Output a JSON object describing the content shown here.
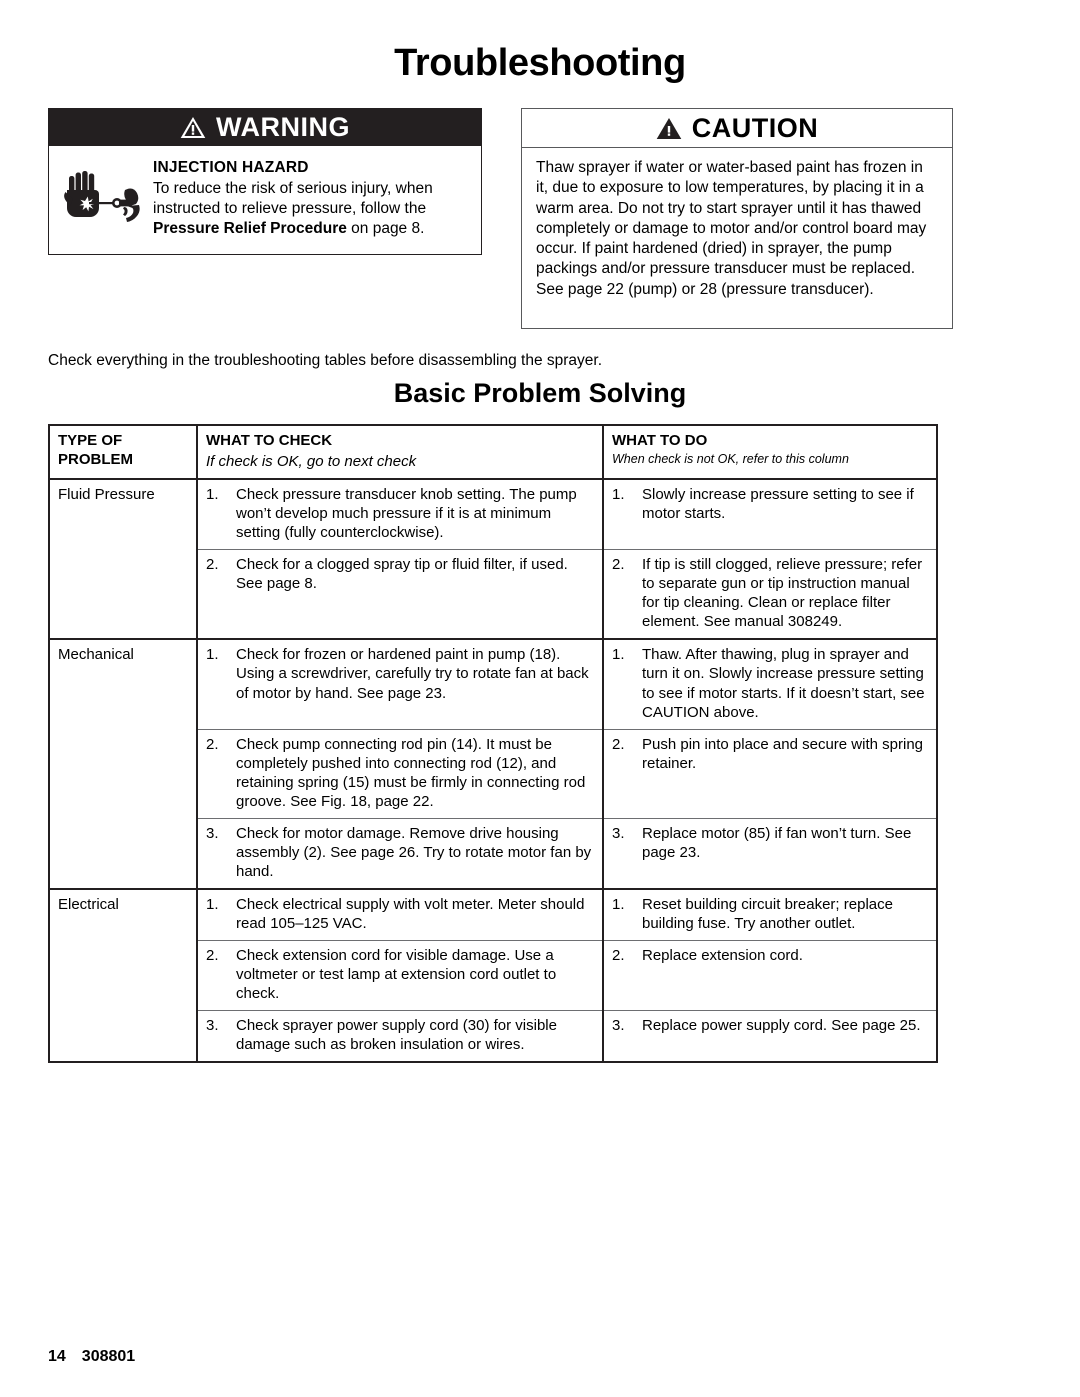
{
  "document": {
    "title": "Troubleshooting"
  },
  "warning": {
    "label": "WARNING",
    "icon": "warning-triangle-icon",
    "hazard_icon": "injection-hazard-hand-spraygun-icon",
    "hazard_title": "INJECTION HAZARD",
    "body_line1": "To reduce the risk of serious injury, when",
    "body_line2": "instructed to relieve pressure, follow the",
    "body_bold": "Pressure Relief Procedure",
    "body_tail": " on page 8."
  },
  "caution": {
    "label": "CAUTION",
    "icon": "caution-triangle-icon",
    "body": "Thaw sprayer if water or water-based paint has frozen in it, due to exposure to low temperatures, by placing it in a warm area. Do not try to start sprayer until it has thawed completely or damage to motor and/or control board may occur. If paint hardened (dried) in sprayer, the pump packings and/or pressure transducer must be replaced. See page 22 (pump) or 28 (pressure transducer)."
  },
  "intro": "Check everything in the troubleshooting tables before disassembling the sprayer.",
  "section_heading": "Basic Problem Solving",
  "table": {
    "headers": {
      "col1_line1": "TYPE OF",
      "col1_line2": "PROBLEM",
      "col2_title": "WHAT TO CHECK",
      "col2_sub": "If check is OK, go to next check",
      "col3_title": "WHAT TO DO",
      "col3_sub": "When check is not OK, refer to this column"
    },
    "groups": [
      {
        "problem": "Fluid Pressure",
        "rows": [
          {
            "num": "1.",
            "check": "Check pressure transducer knob setting. The pump won’t develop much pressure if it is at minimum setting (fully counterclockwise).",
            "do_num": "1.",
            "do": "Slowly increase pressure setting to see if motor starts."
          },
          {
            "num": "2.",
            "check": "Check for a clogged spray tip or fluid filter, if used. See page 8.",
            "do_num": "2.",
            "do": "If tip is still clogged, relieve pressure; refer to separate gun or tip instruction manual for tip cleaning. Clean or replace filter element. See manual 308249."
          }
        ]
      },
      {
        "problem": "Mechanical",
        "rows": [
          {
            "num": "1.",
            "check": "Check for frozen or hardened paint in pump (18). Using a screwdriver, carefully try to rotate fan at back of motor by hand. See page 23.",
            "do_num": "1.",
            "do": "Thaw. After thawing, plug in sprayer and turn it on. Slowly increase pressure setting to see if motor starts. If it doesn’t start, see CAUTION above."
          },
          {
            "num": "2.",
            "check": "Check pump connecting rod pin (14). It must be completely pushed into connecting rod (12), and retaining spring (15) must be firmly in connecting rod groove. See Fig. 18, page 22.",
            "do_num": "2.",
            "do": "Push pin into place and secure with spring retainer."
          },
          {
            "num": "3.",
            "check": "Check for motor damage. Remove drive housing assembly (2). See page 26. Try to rotate motor fan by hand.",
            "do_num": "3.",
            "do": "Replace motor (85) if fan won’t turn.  See page 23."
          }
        ]
      },
      {
        "problem": "Electrical",
        "rows": [
          {
            "num": "1.",
            "check": "Check electrical supply with volt meter. Meter should read 105–125 VAC.",
            "do_num": "1.",
            "do": "Reset building circuit breaker; replace building fuse. Try another outlet."
          },
          {
            "num": "2.",
            "check": "Check extension cord for visible damage. Use a voltmeter or test lamp at extension cord outlet to check.",
            "do_num": "2.",
            "do": "Replace extension cord."
          },
          {
            "num": "3.",
            "check": "Check sprayer power supply cord (30) for visible damage such as broken insulation or wires.",
            "do_num": "3.",
            "do": "Replace power supply cord. See page 25."
          }
        ]
      }
    ]
  },
  "footer": {
    "page_number": "14",
    "manual_number": "308801"
  }
}
